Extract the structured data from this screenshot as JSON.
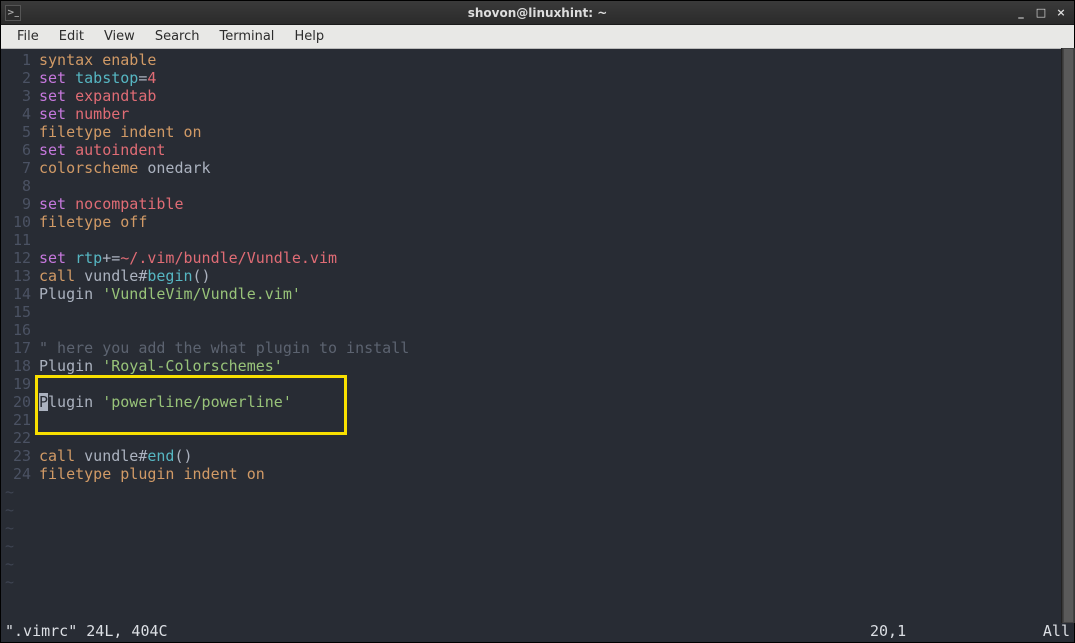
{
  "titlebar": {
    "title": "shovon@linuxhint: ~",
    "icon_label": ">_",
    "minimize": "_",
    "maximize": "□",
    "close": "×"
  },
  "menubar": {
    "items": [
      "File",
      "Edit",
      "View",
      "Search",
      "Terminal",
      "Help"
    ]
  },
  "editor": {
    "lines": [
      {
        "n": 1,
        "tokens": [
          [
            "k-orange",
            "syntax"
          ],
          [
            "k-white",
            " "
          ],
          [
            "k-orange",
            "enable"
          ]
        ]
      },
      {
        "n": 2,
        "tokens": [
          [
            "k-purple",
            "set"
          ],
          [
            "k-white",
            " "
          ],
          [
            "k-teal",
            "tabstop"
          ],
          [
            "k-white",
            "="
          ],
          [
            "k-red",
            "4"
          ]
        ]
      },
      {
        "n": 3,
        "tokens": [
          [
            "k-purple",
            "set"
          ],
          [
            "k-white",
            " "
          ],
          [
            "k-red",
            "expandtab"
          ]
        ]
      },
      {
        "n": 4,
        "tokens": [
          [
            "k-purple",
            "set"
          ],
          [
            "k-white",
            " "
          ],
          [
            "k-red",
            "number"
          ]
        ]
      },
      {
        "n": 5,
        "tokens": [
          [
            "k-orange",
            "filetype"
          ],
          [
            "k-white",
            " "
          ],
          [
            "k-orange",
            "indent"
          ],
          [
            "k-white",
            " "
          ],
          [
            "k-orange",
            "on"
          ]
        ]
      },
      {
        "n": 6,
        "tokens": [
          [
            "k-purple",
            "set"
          ],
          [
            "k-white",
            " "
          ],
          [
            "k-red",
            "autoindent"
          ]
        ]
      },
      {
        "n": 7,
        "tokens": [
          [
            "k-orange",
            "colorscheme"
          ],
          [
            "k-white",
            " onedark"
          ]
        ]
      },
      {
        "n": 8,
        "tokens": []
      },
      {
        "n": 9,
        "tokens": [
          [
            "k-purple",
            "set"
          ],
          [
            "k-white",
            " "
          ],
          [
            "k-red",
            "nocompatible"
          ]
        ]
      },
      {
        "n": 10,
        "tokens": [
          [
            "k-orange",
            "filetype"
          ],
          [
            "k-white",
            " "
          ],
          [
            "k-orange",
            "off"
          ]
        ]
      },
      {
        "n": 11,
        "tokens": []
      },
      {
        "n": 12,
        "tokens": [
          [
            "k-purple",
            "set"
          ],
          [
            "k-white",
            " "
          ],
          [
            "k-teal",
            "rtp"
          ],
          [
            "k-white",
            "+="
          ],
          [
            "k-red",
            "~/.vim/bundle/Vundle.vim"
          ]
        ]
      },
      {
        "n": 13,
        "tokens": [
          [
            "k-orange",
            "call"
          ],
          [
            "k-white",
            " vundle#"
          ],
          [
            "k-teal",
            "begin"
          ],
          [
            "k-white",
            "()"
          ]
        ]
      },
      {
        "n": 14,
        "tokens": [
          [
            "k-white",
            "Plugin "
          ],
          [
            "k-green",
            "'VundleVim/Vundle.vim'"
          ]
        ]
      },
      {
        "n": 15,
        "tokens": []
      },
      {
        "n": 16,
        "tokens": []
      },
      {
        "n": 17,
        "tokens": [
          [
            "k-gray",
            "\" here you add the what plugin to install"
          ]
        ]
      },
      {
        "n": 18,
        "tokens": [
          [
            "k-white",
            "Plugin "
          ],
          [
            "k-green",
            "'Royal-Colorschemes'"
          ]
        ]
      },
      {
        "n": 19,
        "tokens": []
      },
      {
        "n": 20,
        "tokens": [
          [
            "cursor",
            "P"
          ],
          [
            "k-white",
            "lugin "
          ],
          [
            "k-green",
            "'powerline/powerline'"
          ]
        ]
      },
      {
        "n": 21,
        "tokens": []
      },
      {
        "n": 22,
        "tokens": []
      },
      {
        "n": 23,
        "tokens": [
          [
            "k-orange",
            "call"
          ],
          [
            "k-white",
            " vundle#"
          ],
          [
            "k-teal",
            "end"
          ],
          [
            "k-white",
            "()"
          ]
        ]
      },
      {
        "n": 24,
        "tokens": [
          [
            "k-orange",
            "filetype"
          ],
          [
            "k-white",
            " "
          ],
          [
            "k-orange",
            "plugin"
          ],
          [
            "k-white",
            " "
          ],
          [
            "k-orange",
            "indent"
          ],
          [
            "k-white",
            " "
          ],
          [
            "k-orange",
            "on"
          ]
        ]
      }
    ],
    "tilde_count": 6
  },
  "statusbar": {
    "left": "\".vimrc\" 24L, 404C",
    "pos": "20,1",
    "right": "All"
  }
}
